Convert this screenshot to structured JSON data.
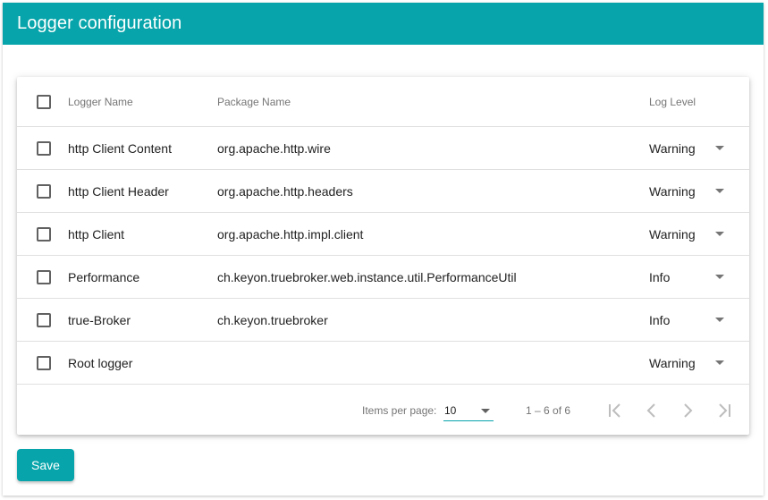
{
  "header": {
    "title": "Logger configuration"
  },
  "table": {
    "columns": {
      "name": "Logger Name",
      "package": "Package Name",
      "level": "Log Level"
    },
    "rows": [
      {
        "name": "http Client Content",
        "package": "org.apache.http.wire",
        "level": "Warning"
      },
      {
        "name": "http Client Header",
        "package": "org.apache.http.headers",
        "level": "Warning"
      },
      {
        "name": "http Client",
        "package": "org.apache.http.impl.client",
        "level": "Warning"
      },
      {
        "name": "Performance",
        "package": "ch.keyon.truebroker.web.instance.util.PerformanceUtil",
        "level": "Info"
      },
      {
        "name": "true-Broker",
        "package": "ch.keyon.truebroker",
        "level": "Info"
      },
      {
        "name": "Root logger",
        "package": "",
        "level": "Warning"
      }
    ]
  },
  "paginator": {
    "items_per_page_label": "Items per page:",
    "page_size": "10",
    "range_label": "1 – 6 of 6"
  },
  "actions": {
    "save_label": "Save"
  },
  "colors": {
    "accent": "#07a5ab",
    "icon_disabled": "#bdbdbd"
  },
  "icons": {
    "checkbox": "checkbox-unchecked",
    "dropdown": "arrow-drop-down",
    "first": "first-page",
    "prev": "chevron-left",
    "next": "chevron-right",
    "last": "last-page"
  }
}
